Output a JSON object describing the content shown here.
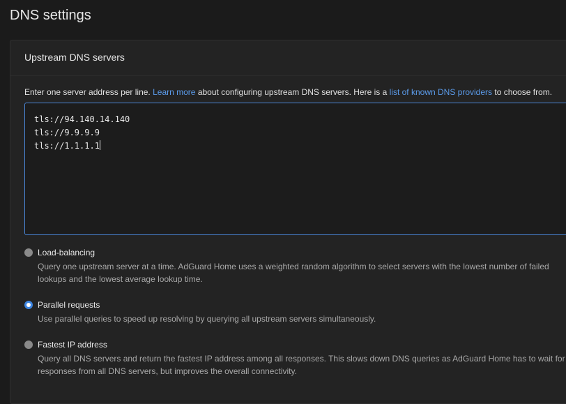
{
  "page_title": "DNS settings",
  "upstream": {
    "section_title": "Upstream DNS servers",
    "help_prefix": "Enter one server address per line.",
    "help_link1": "Learn more",
    "help_middle": "about configuring upstream DNS servers. Here is a",
    "help_link2": "list of known DNS providers",
    "help_suffix": "to choose from.",
    "servers": [
      "tls://94.140.14.140",
      "tls://9.9.9.9",
      "tls://1.1.1.1"
    ],
    "modes": [
      {
        "label": "Load-balancing",
        "description": "Query one upstream server at a time. AdGuard Home uses a weighted random algorithm to select servers with the lowest number of failed lookups and the lowest average lookup time.",
        "selected": false
      },
      {
        "label": "Parallel requests",
        "description": "Use parallel queries to speed up resolving by querying all upstream servers simultaneously.",
        "selected": true
      },
      {
        "label": "Fastest IP address",
        "description": "Query all DNS servers and return the fastest IP address among all responses. This slows down DNS queries as AdGuard Home has to wait for responses from all DNS servers, but improves the overall connectivity.",
        "selected": false
      }
    ]
  },
  "colors": {
    "accent": "#3c84e0",
    "link": "#5b9bea",
    "background": "#1b1b1b",
    "card": "#232323"
  }
}
